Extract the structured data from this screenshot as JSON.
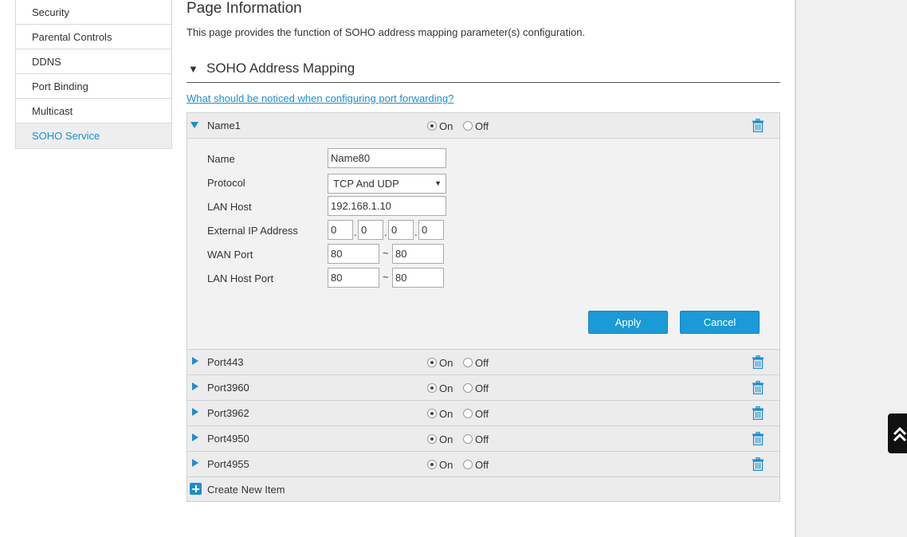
{
  "sidebar": {
    "items": [
      {
        "label": "Security"
      },
      {
        "label": "Parental Controls"
      },
      {
        "label": "DDNS"
      },
      {
        "label": "Port Binding"
      },
      {
        "label": "Multicast"
      },
      {
        "label": "SOHO Service",
        "active": true
      }
    ]
  },
  "page": {
    "title": "Page Information",
    "description": "This page provides the function of SOHO address mapping parameter(s) configuration.",
    "section_title": "SOHO Address Mapping",
    "notice_link": "What should be noticed when configuring port forwarding?"
  },
  "radio": {
    "on_label": "On",
    "off_label": "Off"
  },
  "entries": [
    {
      "name": "Name1",
      "state": "On",
      "expanded": true
    },
    {
      "name": "Port443",
      "state": "On"
    },
    {
      "name": "Port3960",
      "state": "On"
    },
    {
      "name": "Port3962",
      "state": "On"
    },
    {
      "name": "Port4950",
      "state": "On"
    },
    {
      "name": "Port4955",
      "state": "On"
    }
  ],
  "detail": {
    "name_label": "Name",
    "name_value": "Name80",
    "protocol_label": "Protocol",
    "protocol_value": "TCP And UDP",
    "lan_host_label": "LAN Host",
    "lan_host_value": "192.168.1.10",
    "external_ip_label": "External IP Address",
    "external_ip": [
      "0",
      "0",
      "0",
      "0"
    ],
    "wan_port_label": "WAN Port",
    "wan_port_start": "80",
    "wan_port_end": "80",
    "lan_host_port_label": "LAN Host Port",
    "lan_host_port_start": "80",
    "lan_host_port_end": "80",
    "apply_label": "Apply",
    "cancel_label": "Cancel"
  },
  "create_label": "Create New Item",
  "colors": {
    "accent": "#1a8fd1",
    "button": "#1a9ad6"
  },
  "icons": {
    "trash": "trash-icon",
    "expand": "triangle-icon",
    "add": "plus-icon",
    "scroll_top": "double-chevron-up-icon"
  }
}
